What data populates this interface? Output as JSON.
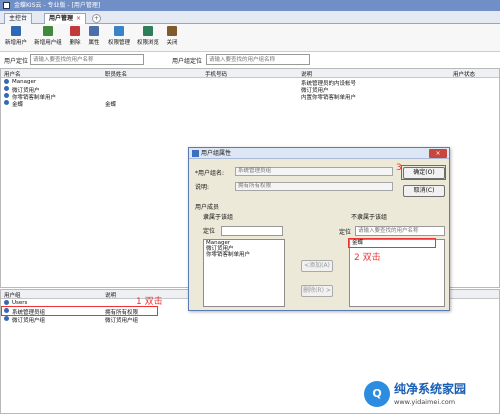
{
  "window": {
    "title": "金蝶KIS云 - 专业版 - [用户管理]"
  },
  "tabs": [
    {
      "label": "主控台"
    },
    {
      "label": "用户管理",
      "close": "×"
    }
  ],
  "toolbar": {
    "items": [
      {
        "label": "新增用户",
        "icon": "new-user-icon",
        "color": "#2f68b5"
      },
      {
        "label": "新增用户组",
        "icon": "new-group-icon",
        "color": "#3f8a3c"
      },
      {
        "label": "删除",
        "icon": "delete-icon",
        "color": "#c23a3a"
      },
      {
        "label": "属性",
        "icon": "properties-icon",
        "color": "#4b6fa8"
      },
      {
        "label": "权限管理",
        "icon": "permission-icon",
        "color": "#3a83c8"
      },
      {
        "label": "权限浏览",
        "icon": "permission-browse-icon",
        "color": "#2e7d5b"
      },
      {
        "label": "关闭",
        "icon": "close-icon",
        "color": "#7f5a2c"
      }
    ]
  },
  "search": {
    "user_locate_label": "用户定位",
    "user_placeholder": "请输入要查找的用户名称",
    "group_locate_label": "用户组定位",
    "group_placeholder": "请输入要查找的用户组名称"
  },
  "user_table": {
    "columns": [
      "用户名",
      "职员姓名",
      "手机号码",
      "说明",
      "用户状态"
    ],
    "rows": [
      {
        "name": "Manager",
        "staff": "",
        "desc": "系统管理员的内设帐号"
      },
      {
        "name": "微订货用户",
        "staff": "",
        "desc": "微订货用户"
      },
      {
        "name": "你零销客制单用户",
        "staff": "",
        "desc": "内置你零销客制单用户"
      },
      {
        "name": "金蝶",
        "staff": "金蝶",
        "desc": ""
      }
    ]
  },
  "group_table": {
    "columns": [
      "用户组",
      "说明"
    ],
    "rows": [
      {
        "name": "Users",
        "desc": ""
      },
      {
        "name": "系统管理员组",
        "desc": "拥有所有权限"
      },
      {
        "name": "微订货用户组",
        "desc": "微订货用户组"
      }
    ]
  },
  "dialog": {
    "title": "用户组属性",
    "close": "×",
    "name_label": "*用户组名:",
    "name_value": "系统管理员组",
    "desc_label": "说明:",
    "desc_value": "拥有所有权限",
    "ok_label": "确定(O)",
    "cancel_label": "取消(C)",
    "members_label": "用户成员",
    "in_group_label": "隶属于该组",
    "not_in_group_label": "不隶属于该组",
    "locate_label": "定位",
    "right_locate_placeholder": "请输入要查找的用户名称",
    "in_group_users": [
      "Manager",
      "微订货用户",
      "你零销客制单用户"
    ],
    "not_in_group_users": [
      "金蝶"
    ],
    "add_button": "<添加(A)",
    "remove_button": "删除(R) >"
  },
  "annotations": {
    "step1": "1 双击",
    "step2": "2 双击",
    "step3": "3",
    "color": "#e33333"
  },
  "watermark": {
    "text": "纯净系统家园",
    "url": "www.yidaimei.com"
  }
}
